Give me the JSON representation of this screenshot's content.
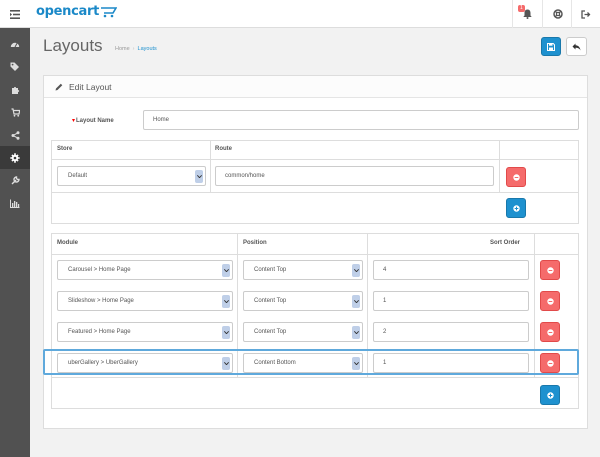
{
  "header": {
    "logo_text": "opencart",
    "notification_count": "1"
  },
  "icons": {
    "menu": "menu-icon",
    "bell": "bell-icon",
    "help": "life-ring-icon",
    "logout": "sign-out-icon"
  },
  "sidebar": {
    "items": [
      {
        "icon": "dashboard-icon"
      },
      {
        "icon": "tags-icon"
      },
      {
        "icon": "puzzle-icon"
      },
      {
        "icon": "cart-icon"
      },
      {
        "icon": "share-icon"
      },
      {
        "icon": "cog-icon",
        "active": true
      },
      {
        "icon": "wrench-icon"
      },
      {
        "icon": "bar-chart-icon"
      }
    ]
  },
  "page": {
    "title": "Layouts",
    "breadcrumb": [
      "Home",
      "Layouts"
    ]
  },
  "panel": {
    "title": "Edit Layout",
    "layout_name_label": "Layout Name",
    "layout_name_value": "Home"
  },
  "route_table": {
    "headers": [
      "Store",
      "Route"
    ],
    "rows": [
      {
        "store": "Default",
        "route": "common/home"
      }
    ]
  },
  "module_table": {
    "headers": [
      "Module",
      "Position",
      "Sort Order"
    ],
    "rows": [
      {
        "module": "Carousel > Home Page",
        "position": "Content Top",
        "sort": "4"
      },
      {
        "module": "Slideshow > Home Page",
        "position": "Content Top",
        "sort": "1"
      },
      {
        "module": "Featured > Home Page",
        "position": "Content Top",
        "sort": "2"
      },
      {
        "module": "uberGallery > UberGallery",
        "position": "Content Bottom",
        "sort": "1"
      }
    ]
  },
  "colors": {
    "primary": "#1e91cf",
    "danger": "#f56b6b",
    "sidebar": "#515151",
    "highlight": "#5fa9dc"
  }
}
